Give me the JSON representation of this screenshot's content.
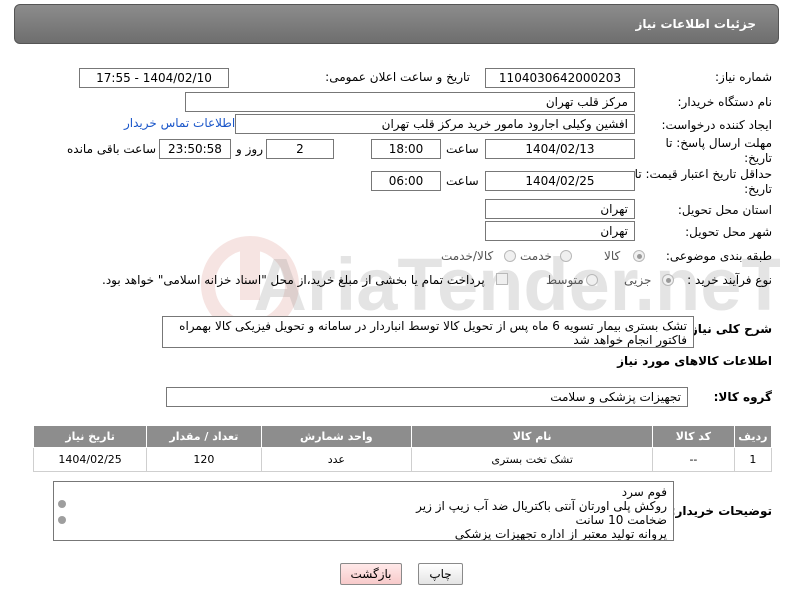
{
  "header": {
    "title": "جزئیات اطلاعات نیاز"
  },
  "form": {
    "need_number_label": "شماره نیاز:",
    "need_number": "1104030642000203",
    "announce_label": "تاریخ و ساعت اعلان عمومی:",
    "announce_value": "1404/02/10 - 17:55",
    "buyer_org_label": "نام دستگاه خریدار:",
    "buyer_org": "مرکز قلب تهران",
    "requester_label": "ایجاد کننده درخواست:",
    "requester": "افشین وکیلی اجارود مامور خرید مرکز قلب تهران",
    "contact_link": "اطلاعات تماس خریدار",
    "reply_deadline_label": "مهلت ارسال پاسخ: تا تاریخ:",
    "reply_date": "1404/02/13",
    "hour_label": "ساعت",
    "reply_time": "18:00",
    "days_value": "2",
    "days_label": "روز و",
    "remaining_time": "23:50:58",
    "remaining_label": "ساعت باقی مانده",
    "price_validity_label": "حداقل تاریخ اعتبار قیمت: تا تاریخ:",
    "price_date": "1404/02/25",
    "hour_label_2": "ساعت",
    "price_time": "06:00",
    "province_label": "استان محل تحویل:",
    "province": "تهران",
    "city_label": "شهر محل تحویل:",
    "city": "تهران",
    "category_label": "طبقه بندی موضوعی:",
    "category_options": [
      "کالا",
      "خدمت",
      "کالا/خدمت"
    ],
    "purchase_type_label": "نوع فرآیند خرید :",
    "purchase_options": [
      "جزیی",
      "متوسط"
    ],
    "payment_note": "پرداخت تمام یا بخشی از مبلغ خرید،از محل \"اسناد خزانه اسلامی\" خواهد بود.",
    "desc_label": "شرح کلی نیاز:",
    "description": "تشک بستری بیمار تسویه 6 ماه پس از تحویل کالا توسط انباردار در سامانه و تحویل فیزیکی کالا بهمراه فاکتور انجام خواهد شد"
  },
  "goods": {
    "section_title": "اطلاعات کالاهای مورد نیاز",
    "group_label": "گروه کالا:",
    "group_value": "تجهیزات پزشکی و سلامت",
    "columns": [
      "ردیف",
      "کد کالا",
      "نام کالا",
      "واحد شمارش",
      "تعداد / مقدار",
      "تاریخ نیاز"
    ],
    "rows": [
      [
        "1",
        "--",
        "تشک تخت بستری",
        "عدد",
        "120",
        "1404/02/25"
      ]
    ]
  },
  "buyer_notes": {
    "label": "توضیحات خریدار:",
    "lines": [
      "فوم سرد",
      "روکش پلی اورتان آنتی باکتریال ضد آب زیپ از زیر",
      "ضخامت 10 سانت",
      "پروانه تولید معتبر از اداره تجهیزات پزشکی"
    ]
  },
  "buttons": {
    "print": "چاپ",
    "back": "بازگشت"
  },
  "watermark": {
    "text": "AriaTender.neT"
  },
  "colors": {
    "header_bg": "#7a7a7a",
    "link": "#1a56c9",
    "table_header": "#8d8d8d",
    "back_button": "#f7caca"
  }
}
